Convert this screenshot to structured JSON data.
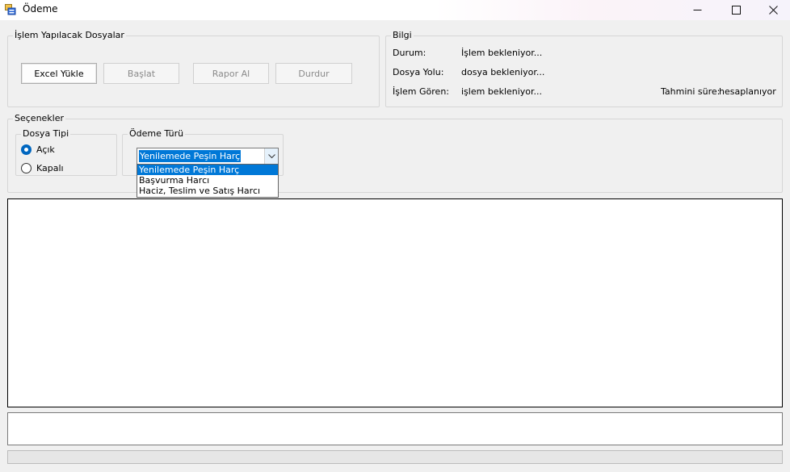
{
  "window": {
    "title": "Ödeme",
    "controls": {
      "minimize": "—",
      "maximize": "☐",
      "close": "✕"
    }
  },
  "files_group": {
    "legend": "İşlem Yapılacak Dosyalar",
    "buttons": {
      "excel_load": "Excel Yükle",
      "start": "Başlat",
      "report": "Rapor Al",
      "stop": "Durdur"
    }
  },
  "info_group": {
    "legend": "Bilgi",
    "status_label": "Durum:",
    "status_value": "İşlem bekleniyor...",
    "path_label": "Dosya Yolu:",
    "path_value": "dosya bekleniyor...",
    "processed_label": "İşlem Gören:",
    "processed_value": "işlem bekleniyor...",
    "eta_label": "Tahmini süre:",
    "eta_value": "hesaplanıyor"
  },
  "options_group": {
    "legend": "Seçenekler",
    "file_type": {
      "legend": "Dosya Tipi",
      "open_label": "Açık",
      "closed_label": "Kapalı",
      "selected": "Açık"
    },
    "payment_type": {
      "legend": "Ödeme Türü",
      "selected": "Yenilemede Peşin Harç",
      "options": [
        "Yenilemede Peşin Harç",
        "Başvurma Harcı",
        "Haciz, Teslim ve Satış Harcı"
      ]
    }
  },
  "log": {
    "text": ""
  },
  "status_box": {
    "text": ""
  },
  "progress": {
    "value": 0
  },
  "colors": {
    "accent": "#0078d7",
    "radio_checked": "#0067c0",
    "progress": "#06b025"
  },
  "icons": {
    "app": "form-icon",
    "combo_arrow": "chevron-down-icon"
  }
}
